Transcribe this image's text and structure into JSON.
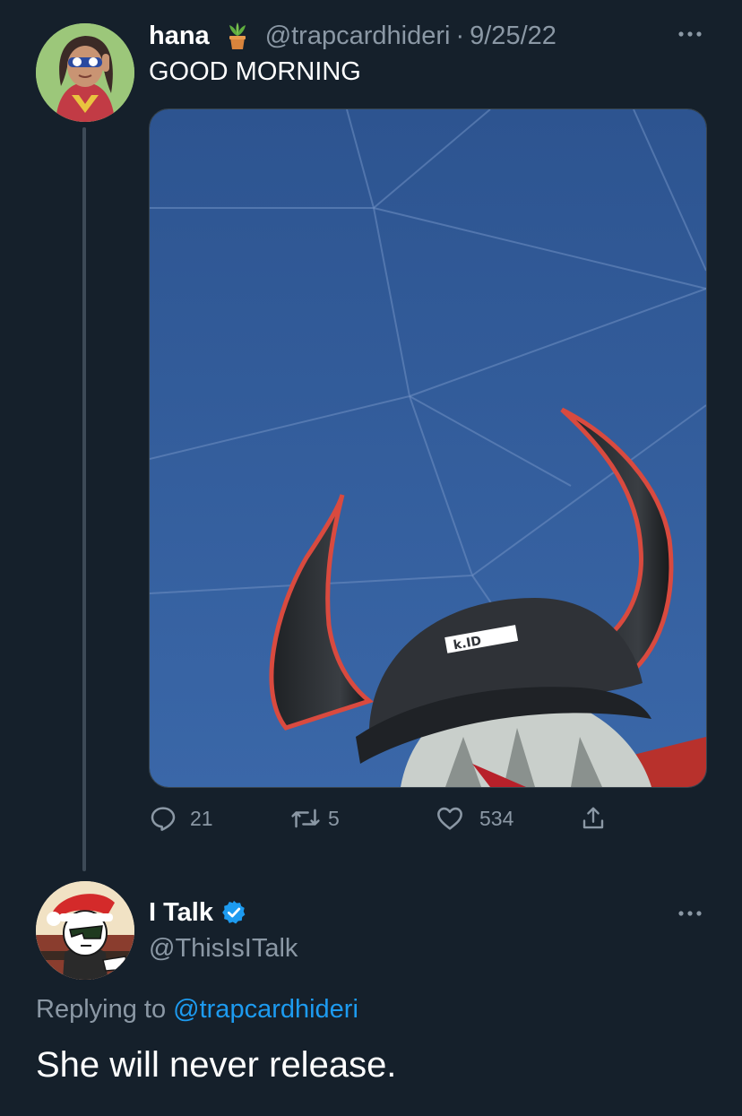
{
  "tweet": {
    "name": "hana",
    "name_emoji": "potted-plant",
    "handle": "@trapcardhideri",
    "separator": "·",
    "date": "9/25/22",
    "text": "GOOD MORNING",
    "actions": {
      "replies": "21",
      "retweets": "5",
      "likes": "534"
    },
    "media_watermark": "k.ID"
  },
  "reply": {
    "name": "I Talk",
    "verified": true,
    "handle": "@ThisIsITalk",
    "replying_prefix": "Replying to",
    "replying_handle": "@trapcardhideri",
    "text": "She will never release."
  },
  "colors": {
    "background": "#15202b",
    "muted": "#8b98a5",
    "link": "#1d9bf0",
    "verified": "#1d9bf0"
  }
}
